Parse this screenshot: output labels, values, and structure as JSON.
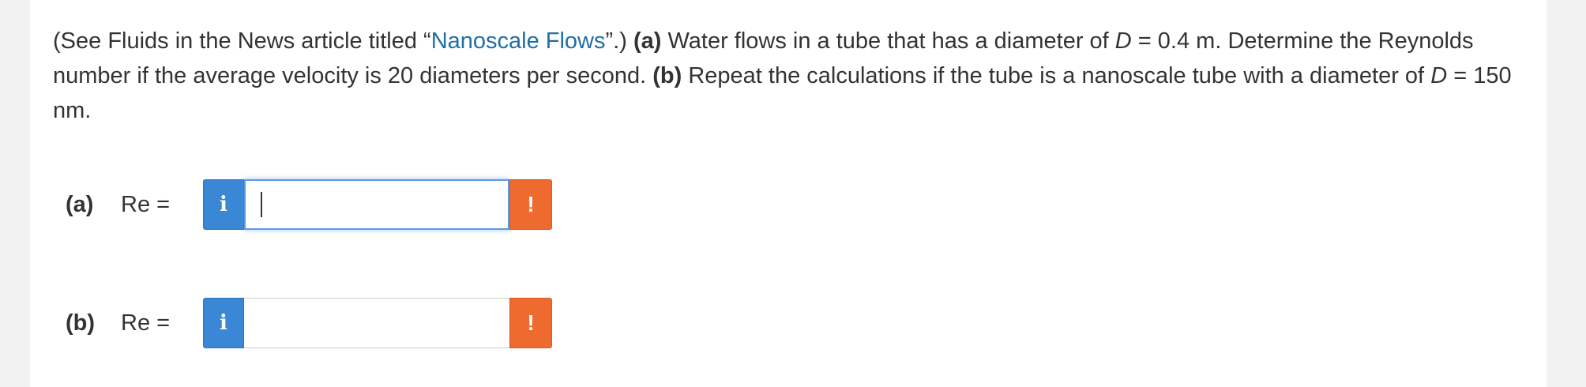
{
  "question": {
    "prefix": "(See Fluids in the News article titled “",
    "link_text": "Nanoscale Flows",
    "after_link": "”.) ",
    "part_a_label": "(a)",
    "part_a_text_1": " Water flows in a tube that has a diameter of ",
    "var_d": "D",
    "part_a_text_2": " = 0.4 m. Determine the Reynolds number if the average velocity is 20 diameters per second. ",
    "part_b_label": "(b)",
    "part_b_text_1": " Repeat the calculations if the tube is a nanoscale tube with a diameter of ",
    "part_b_text_2": " = 150 nm."
  },
  "answers": [
    {
      "part": "(a)",
      "equation": "Re =",
      "info_icon": "i",
      "value": "",
      "alert_icon": "!",
      "focused": true
    },
    {
      "part": "(b)",
      "equation": "Re =",
      "info_icon": "i",
      "value": "",
      "alert_icon": "!",
      "focused": false
    }
  ],
  "colors": {
    "link": "#1f6fa5",
    "info_button": "#3a87d6",
    "alert_button": "#ee6a2f",
    "focus_border": "#5b9be3"
  }
}
